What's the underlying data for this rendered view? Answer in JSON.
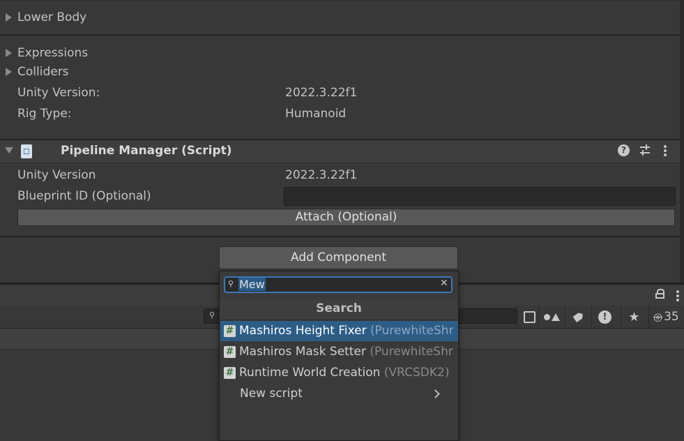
{
  "inspector": {
    "foldouts": [
      "Lower Body",
      "Expressions",
      "Colliders"
    ],
    "unity_version": {
      "label": "Unity Version:",
      "value": "2022.3.22f1"
    },
    "rig_type": {
      "label": "Rig Type:",
      "value": "Humanoid"
    }
  },
  "pipeline": {
    "title": "Pipeline Manager (Script)",
    "unity_version_label": "Unity Version",
    "unity_version_value": "2022.3.22f1",
    "blueprint_label": "Blueprint ID (Optional)",
    "blueprint_value": "",
    "attach_label": "Attach (Optional)"
  },
  "add_component": {
    "button_label": "Add Component",
    "search_value": "Mew",
    "header": "Search",
    "results": [
      {
        "name": "Mashiros Height Fixer",
        "source": "(PurewhiteShr",
        "selected": true
      },
      {
        "name": "Mashiros Mask Setter",
        "source": "(PurewhiteShr",
        "selected": false
      },
      {
        "name": "Runtime World Creation",
        "source": "(VRCSDK2)",
        "selected": false
      }
    ],
    "new_script_label": "New script"
  },
  "lower_panel": {
    "visibility_count": "35"
  },
  "colors": {
    "background": "#383838",
    "selection": "#2c5d87",
    "search_focus": "#3a79bb"
  }
}
